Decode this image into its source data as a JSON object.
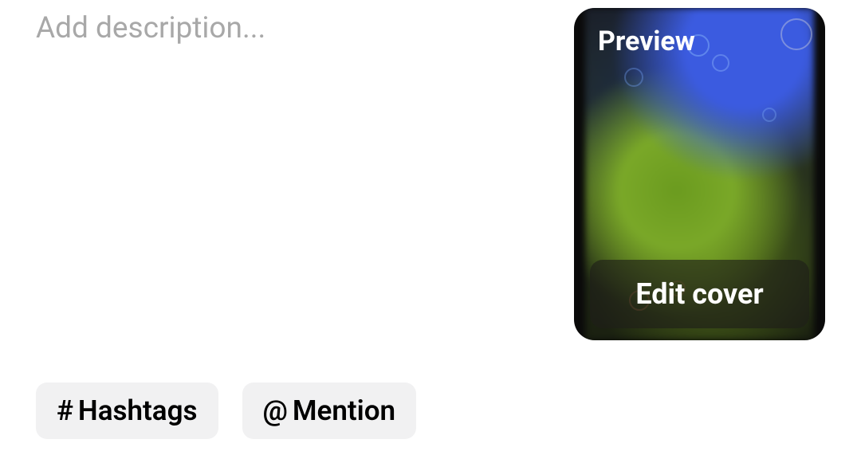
{
  "description": {
    "placeholder": "Add description...",
    "value": ""
  },
  "preview": {
    "label": "Preview",
    "edit_cover_label": "Edit cover"
  },
  "buttons": {
    "hashtags": {
      "icon": "#",
      "label": "Hashtags"
    },
    "mention": {
      "icon": "@",
      "label": "Mention"
    }
  }
}
